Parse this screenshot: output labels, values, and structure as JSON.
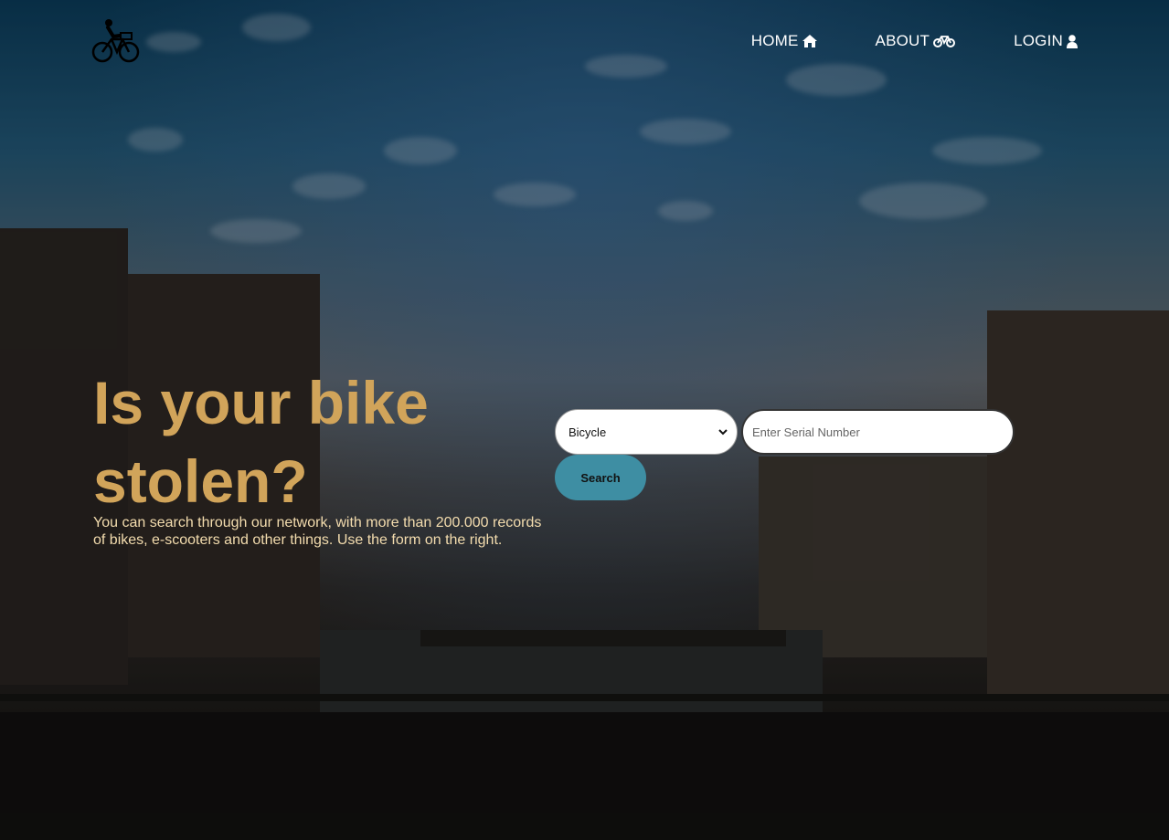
{
  "nav": {
    "home_label": "HOME",
    "about_label": "ABOUT",
    "login_label": "LOGIN"
  },
  "hero": {
    "title": "Is your bike stolen?",
    "description": "You can search through our network, with more than 200.000 records of bikes, e-scooters and other things. Use the form on the right."
  },
  "search_form": {
    "type_value": "Bicycle",
    "serial_placeholder": "Enter Serial Number",
    "serial_value": "",
    "search_label": "Search"
  },
  "colors": {
    "title": "#d1a45a",
    "description": "#f3dcae",
    "search_button": "#3e8ea3"
  },
  "icons": {
    "logo": "cyclist-logo-icon",
    "home": "home-icon",
    "about": "bicycle-icon",
    "login": "user-icon",
    "select": "chevron-down-icon"
  }
}
